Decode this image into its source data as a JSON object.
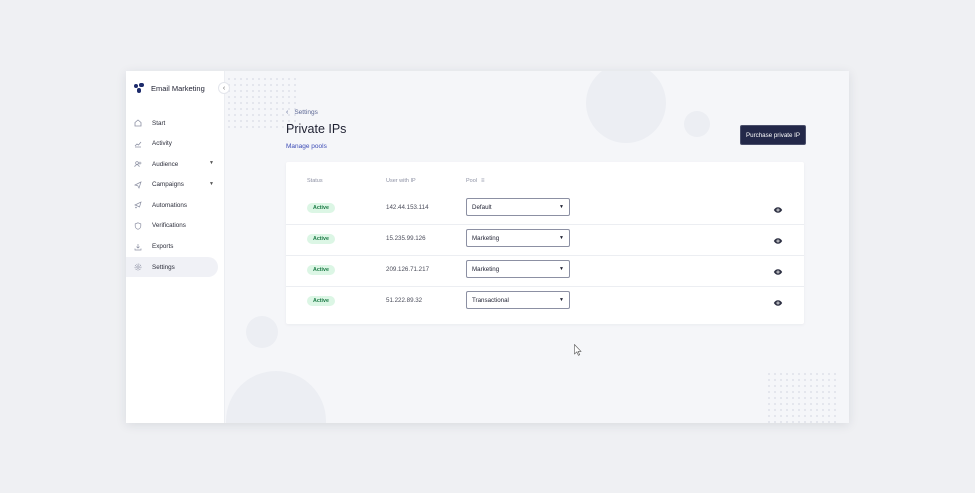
{
  "app": {
    "name": "Email Marketing"
  },
  "sidebar": {
    "items": [
      {
        "label": "Start",
        "icon": "home-icon",
        "active": false,
        "expandable": false
      },
      {
        "label": "Activity",
        "icon": "chart-icon",
        "active": false,
        "expandable": false
      },
      {
        "label": "Audience",
        "icon": "users-icon",
        "active": false,
        "expandable": true
      },
      {
        "label": "Campaigns",
        "icon": "send-icon",
        "active": false,
        "expandable": true
      },
      {
        "label": "Automations",
        "icon": "automation-icon",
        "active": false,
        "expandable": false
      },
      {
        "label": "Verifications",
        "icon": "shield-icon",
        "active": false,
        "expandable": false
      },
      {
        "label": "Exports",
        "icon": "download-icon",
        "active": false,
        "expandable": false
      },
      {
        "label": "Settings",
        "icon": "gear-icon",
        "active": true,
        "expandable": false
      }
    ]
  },
  "breadcrumb": {
    "label": "Settings"
  },
  "page": {
    "title": "Private IPs",
    "manage_link": "Manage pools",
    "purchase_button": "Purchase private IP"
  },
  "table": {
    "headers": {
      "status": "Status",
      "user_ip": "User with IP",
      "pool": "Pool"
    },
    "rows": [
      {
        "status": "Active",
        "ip": "142.44.153.114",
        "pool": "Default"
      },
      {
        "status": "Active",
        "ip": "15.235.99.126",
        "pool": "Marketing"
      },
      {
        "status": "Active",
        "ip": "209.126.71.217",
        "pool": "Marketing"
      },
      {
        "status": "Active",
        "ip": "51.222.89.32",
        "pool": "Transactional"
      }
    ]
  },
  "colors": {
    "primary_button": "#232849",
    "link": "#3b4ab5",
    "badge_bg": "#dcf6e5",
    "badge_text": "#1b7a45",
    "page_bg": "#eff0f3"
  }
}
